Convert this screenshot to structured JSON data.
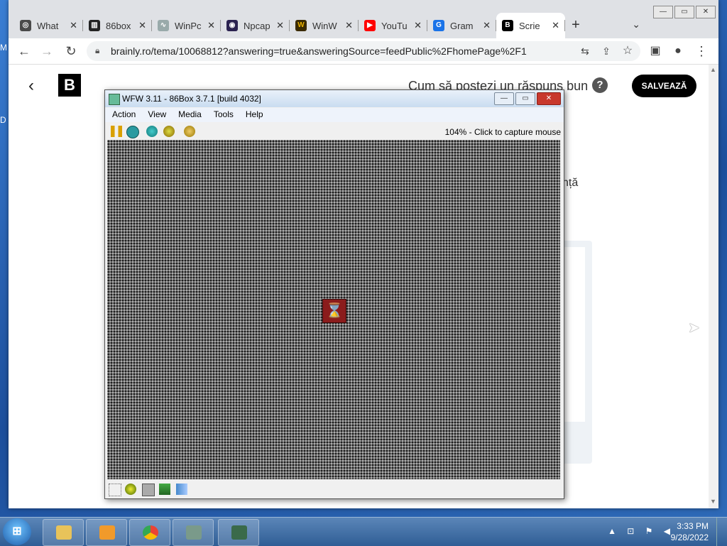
{
  "desktop": {
    "letter_top": "M",
    "letter_mid": "D"
  },
  "window": {
    "minimize": "—",
    "maximize": "▭",
    "close": "✕"
  },
  "tabs": [
    {
      "title": "What",
      "color": "#4a4a4a",
      "icon": "chrome-icon"
    },
    {
      "title": "86box",
      "color": "#222222",
      "icon": "building-icon"
    },
    {
      "title": "WinPc",
      "color": "#9aa",
      "icon": "waveform-icon"
    },
    {
      "title": "Npcap",
      "color": "#2b2250",
      "icon": "eye-icon"
    },
    {
      "title": "WinW",
      "color": "#3a2a00",
      "icon": "w-logo-icon"
    },
    {
      "title": "YouTu",
      "color": "#ff0000",
      "icon": "youtube-icon"
    },
    {
      "title": "Gram",
      "color": "#1a73e8",
      "icon": "google-icon"
    },
    {
      "title": "Scrie",
      "color": "#000000",
      "icon": "brainly-icon"
    }
  ],
  "new_tab": "+",
  "tab_menu": "⌄",
  "toolbar": {
    "back": "←",
    "forward": "→",
    "reload": "↻",
    "url": "brainly.ro/tema/10068812?answering=true&answeringSource=feedPublic%2FhomePage%2F1",
    "translate": "⇆",
    "share": "⇪",
    "bookmark": "☆",
    "sidepanel": "▣",
    "profile": "●",
    "menu": "⋮"
  },
  "page": {
    "back_arrow": "‹",
    "logo": "B",
    "hint": "Cum să postezi un răspuns bun",
    "help": "?",
    "save": "SALVEAZĂ",
    "partial_text": "nță"
  },
  "box": {
    "title": "WFW 3.11 - 86Box 3.7.1 [build 4032]",
    "menu": [
      "Action",
      "View",
      "Media",
      "Tools",
      "Help"
    ],
    "capture": "104% - Click to capture mouse",
    "minimize": "—",
    "maximize": "▭",
    "close": "✕",
    "hourglass": "⌛"
  },
  "taskbar": {
    "start": "⊞",
    "tray_icons": "▲ ⊡ ⚑ ◀",
    "time": "3:33 PM",
    "date": "9/28/2022"
  }
}
